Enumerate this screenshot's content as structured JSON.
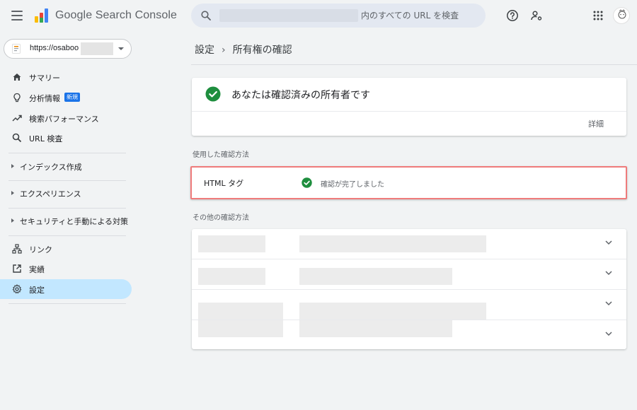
{
  "app": {
    "title": "Google Search Console"
  },
  "search": {
    "placeholder": "内のすべての URL を検査"
  },
  "property": {
    "label": "https://osaboo"
  },
  "sidebar": {
    "items": [
      {
        "label": "サマリー",
        "icon": "home-icon"
      },
      {
        "label": "分析情報",
        "icon": "lightbulb-icon",
        "badge": "新規"
      },
      {
        "label": "検索パフォーマンス",
        "icon": "trending-up-icon"
      },
      {
        "label": "URL 検査",
        "icon": "search-icon"
      }
    ],
    "groups": [
      {
        "label": "インデックス作成"
      },
      {
        "label": "エクスペリエンス"
      },
      {
        "label": "セキュリティと手動による対策"
      }
    ],
    "bottom_items": [
      {
        "label": "リンク",
        "icon": "sitemap-icon"
      },
      {
        "label": "実績",
        "icon": "open-in-new-icon"
      },
      {
        "label": "設定",
        "icon": "gear-icon",
        "active": true
      }
    ]
  },
  "breadcrumb": {
    "parent": "設定",
    "current": "所有権の確認"
  },
  "owner_card": {
    "title": "あなたは確認済みの所有者です",
    "details": "詳細"
  },
  "used_method": {
    "section_label": "使用した確認方法",
    "name": "HTML タグ",
    "status": "確認が完了しました"
  },
  "other_methods": {
    "section_label": "その他の確認方法"
  },
  "colors": {
    "accent": "#1a73e8",
    "success": "#1e8e3e",
    "active_nav": "#c2e7ff",
    "highlight_border": "#ef7b7b"
  }
}
